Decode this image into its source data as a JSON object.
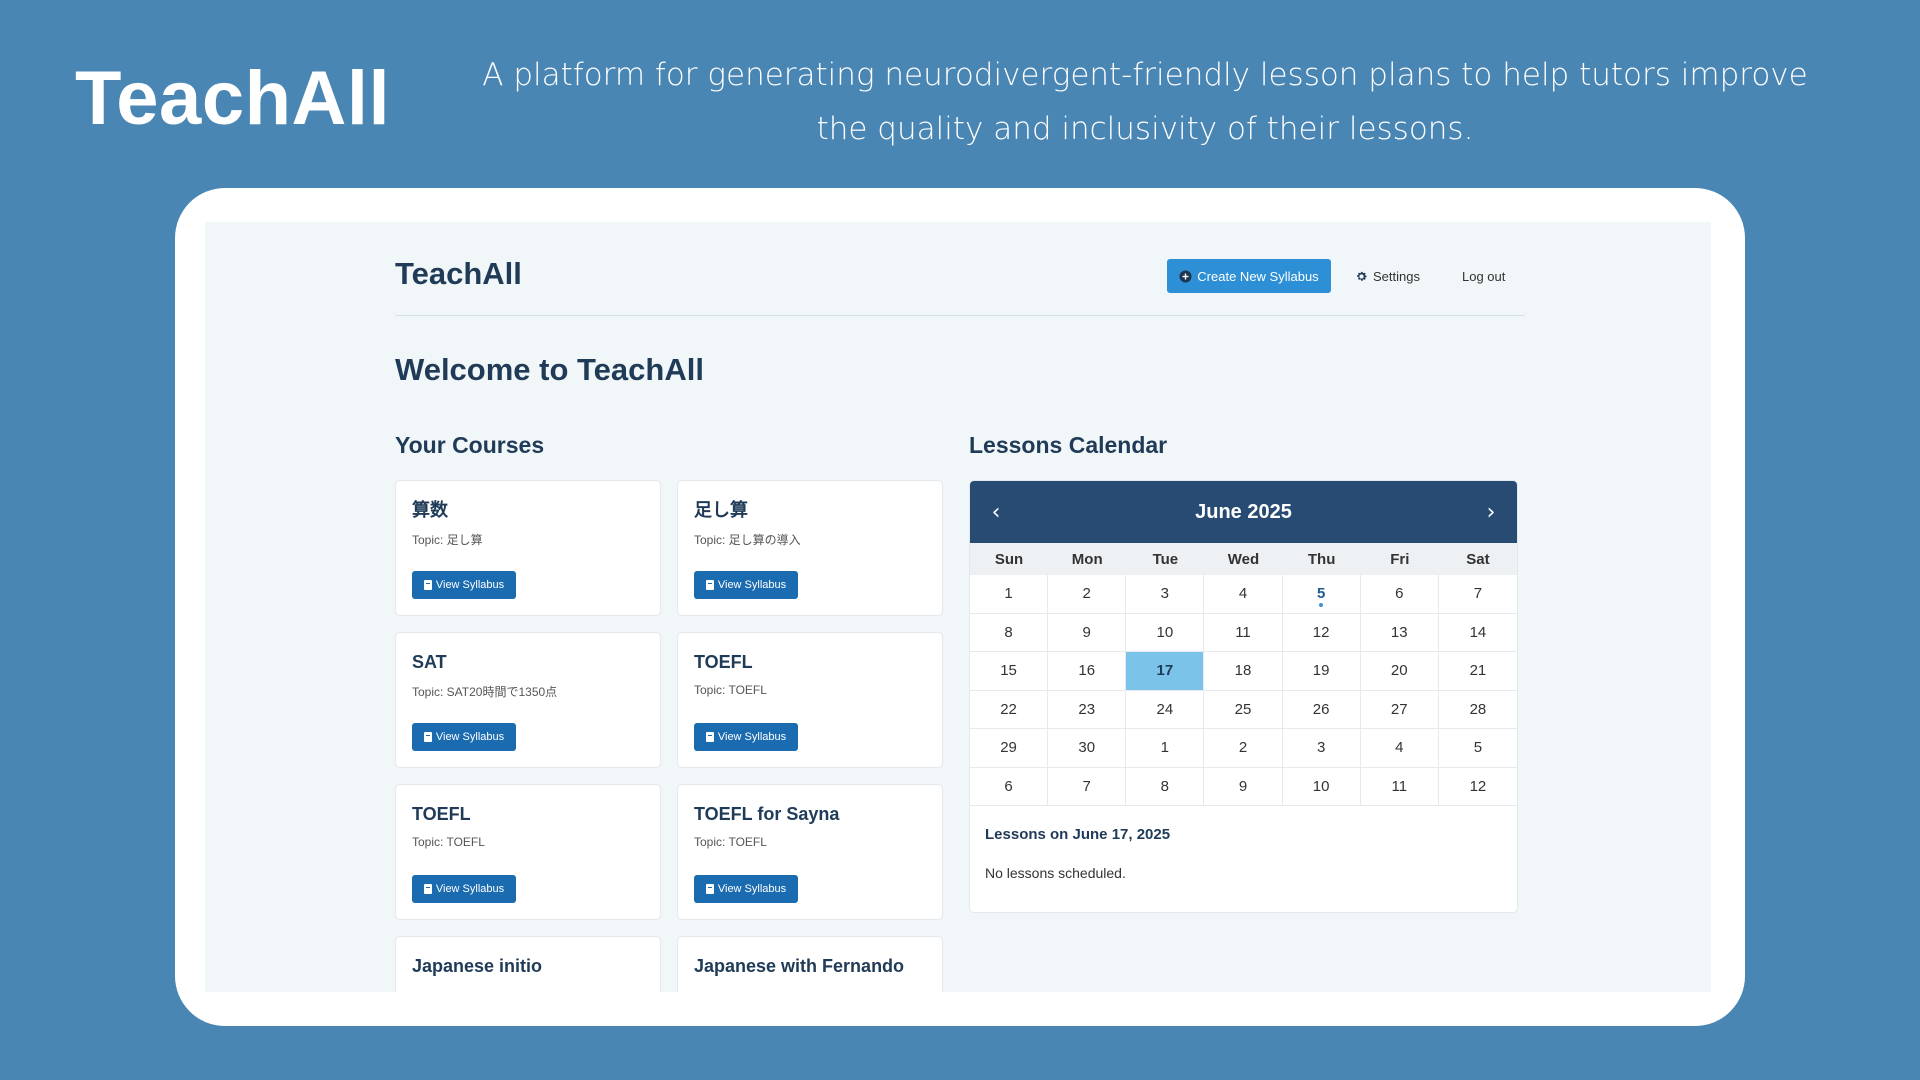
{
  "promo": {
    "title": "TeachAll",
    "tagline": "A platform for generating neurodivergent-friendly lesson plans to help tutors improve the quality and inclusivity of their lessons."
  },
  "header": {
    "logo": "TeachAll",
    "create_label": "Create New Syllabus",
    "settings_label": "Settings",
    "logout_label": "Log out"
  },
  "page_title": "Welcome to TeachAll",
  "courses_title": "Your Courses",
  "calendar_title": "Lessons Calendar",
  "view_label": "View Syllabus",
  "courses": [
    {
      "name": "算数",
      "topic": "Topic: 足し算"
    },
    {
      "name": "足し算",
      "topic": "Topic: 足し算の導入"
    },
    {
      "name": "SAT",
      "topic": "Topic: SAT20時間で1350点"
    },
    {
      "name": "TOEFL",
      "topic": "Topic: TOEFL"
    },
    {
      "name": "TOEFL",
      "topic": "Topic: TOEFL"
    },
    {
      "name": "TOEFL for Sayna",
      "topic": "Topic: TOEFL"
    },
    {
      "name": "Japanese initio",
      "topic": ""
    },
    {
      "name": "Japanese with Fernando",
      "topic": ""
    }
  ],
  "calendar": {
    "month": "June 2025",
    "prev_icon": "‹",
    "next_icon": "›",
    "days_of_week": [
      "Sun",
      "Mon",
      "Tue",
      "Wed",
      "Thu",
      "Fri",
      "Sat"
    ],
    "days": [
      "1",
      "2",
      "3",
      "4",
      "5",
      "6",
      "7",
      "8",
      "9",
      "10",
      "11",
      "12",
      "13",
      "14",
      "15",
      "16",
      "17",
      "18",
      "19",
      "20",
      "21",
      "22",
      "23",
      "24",
      "25",
      "26",
      "27",
      "28",
      "29",
      "30",
      "1",
      "2",
      "3",
      "4",
      "5",
      "6",
      "7",
      "8",
      "9",
      "10",
      "11",
      "12"
    ],
    "today_index": 16,
    "lesson_indices": [
      4
    ],
    "footer_title": "Lessons on June 17, 2025",
    "footer_text": "No lessons scheduled."
  },
  "colors": {
    "background": "#4a86b3",
    "accent": "#2d8fd5",
    "calendar_header": "#284b73",
    "today": "#7cc3ea"
  }
}
